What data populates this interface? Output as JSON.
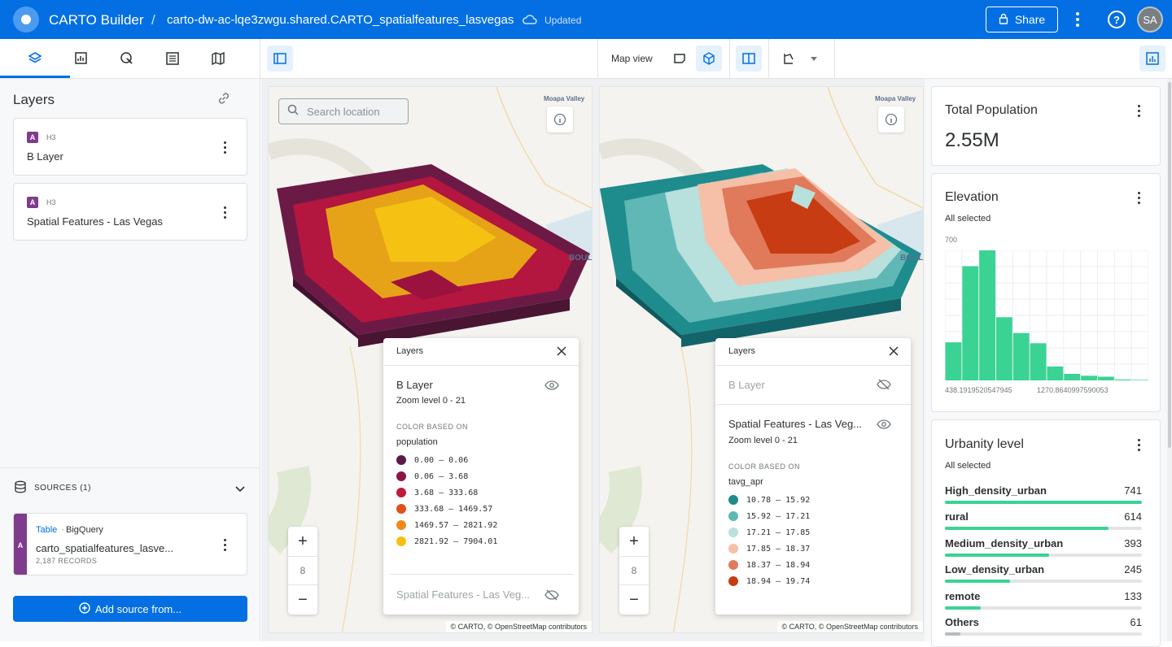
{
  "header": {
    "app_title": "CARTO Builder",
    "separator": "/",
    "map_name": "carto-dw-ac-lqe3zwgu.shared.CARTO_spatialfeatures_lasvegas",
    "save_status": "Updated",
    "share_label": "Share",
    "avatar_initials": "SA"
  },
  "toolbar": {
    "map_view_label": "Map view"
  },
  "layers_panel": {
    "title": "Layers",
    "layers": [
      {
        "badge": "A",
        "type": "H3",
        "name": "B Layer"
      },
      {
        "badge": "A",
        "type": "H3",
        "name": "Spatial Features - Las Vegas"
      }
    ]
  },
  "sources": {
    "title": "SOURCES (1)",
    "items": [
      {
        "badge": "A",
        "kind": "Table",
        "provider": "BigQuery",
        "name": "carto_spatialfeatures_lasve...",
        "records": "2,187 RECORDS"
      }
    ],
    "add_label": "Add source from..."
  },
  "map_left": {
    "search_placeholder": "Search location",
    "place_label": "Moapa Valley",
    "place_label_2": "BOUL",
    "zoom_level": "8",
    "attribution": "© CARTO, © OpenStreetMap contributors",
    "legend": {
      "header": "Layers",
      "active_layer": "B Layer",
      "zoom_range": "Zoom level 0 - 21",
      "color_based_on": "COLOR BASED ON",
      "field": "population",
      "rows": [
        {
          "label": "0.00 – 0.06",
          "color": "#5c1a47"
        },
        {
          "label": "0.06 – 3.68",
          "color": "#8c1447"
        },
        {
          "label": "3.68 – 333.68",
          "color": "#c01a3f"
        },
        {
          "label": "333.68 – 1469.57",
          "color": "#e0511d"
        },
        {
          "label": "1469.57 – 2821.92",
          "color": "#f0891a"
        },
        {
          "label": "2821.92 – 7904.01",
          "color": "#f5bf13"
        }
      ],
      "hidden_layer": "Spatial Features - Las Veg..."
    }
  },
  "map_right": {
    "place_label": "Moapa Valley",
    "place_label_2": "BOUL",
    "zoom_level": "8",
    "attribution": "© CARTO, © OpenStreetMap contributors",
    "legend": {
      "header": "Layers",
      "hidden_layer": "B Layer",
      "active_layer": "Spatial Features - Las Veg...",
      "zoom_range": "Zoom level 0 - 21",
      "color_based_on": "COLOR BASED ON",
      "field": "tavg_apr",
      "rows": [
        {
          "label": "10.78 – 15.92",
          "color": "#1e8c8c"
        },
        {
          "label": "15.92 – 17.21",
          "color": "#5fb8b5"
        },
        {
          "label": "17.21 – 17.85",
          "color": "#b8e0dd"
        },
        {
          "label": "17.85 – 18.37",
          "color": "#f5bfa8"
        },
        {
          "label": "18.37 – 18.94",
          "color": "#e07a5a"
        },
        {
          "label": "18.94 – 19.74",
          "color": "#c73c12"
        }
      ]
    }
  },
  "widgets": {
    "population": {
      "title": "Total Population",
      "value": "2.55M"
    },
    "elevation": {
      "title": "Elevation",
      "selection": "All selected",
      "y_max_label": "700",
      "x_min_label": "438.1919520547945",
      "x_mid_label": "1270.8640997590053"
    },
    "urbanity": {
      "title": "Urbanity level",
      "selection": "All selected",
      "rows": [
        {
          "name": "High_density_urban",
          "value": "741",
          "fraction": 1.0
        },
        {
          "name": "rural",
          "value": "614",
          "fraction": 0.83
        },
        {
          "name": "Medium_density_urban",
          "value": "393",
          "fraction": 0.53
        },
        {
          "name": "Low_density_urban",
          "value": "245",
          "fraction": 0.33
        },
        {
          "name": "remote",
          "value": "133",
          "fraction": 0.18
        },
        {
          "name": "Others",
          "value": "61",
          "fraction": 0.08
        }
      ]
    }
  },
  "chart_data": {
    "type": "bar",
    "title": "Elevation",
    "ylim": [
      0,
      700
    ],
    "categories": [
      "1",
      "2",
      "3",
      "4",
      "5",
      "6",
      "7",
      "8",
      "9",
      "10",
      "11",
      "12"
    ],
    "values": [
      205,
      615,
      700,
      340,
      255,
      200,
      75,
      35,
      25,
      20,
      5,
      3
    ],
    "x_tick_labels": [
      "438.1919520547945",
      "1270.8640997590053"
    ],
    "color": "#3ad393"
  }
}
